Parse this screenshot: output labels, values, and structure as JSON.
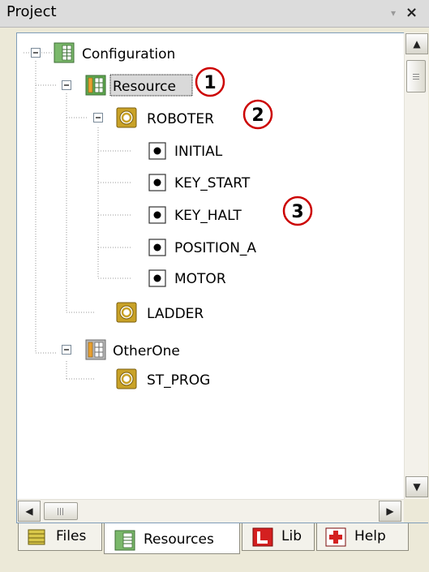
{
  "panel": {
    "title": "Project",
    "pin_glyph": "▾",
    "close_glyph": "×"
  },
  "tree": {
    "root": {
      "label": "Configuration",
      "icon": "configuration-icon"
    },
    "resource": {
      "label": "Resource",
      "icon": "resource-icon",
      "selected": true
    },
    "roboter": {
      "label": "ROBOTER",
      "icon": "program-icon"
    },
    "variables": [
      {
        "label": "INITIAL",
        "icon": "variable-icon"
      },
      {
        "label": "KEY_START",
        "icon": "variable-icon"
      },
      {
        "label": "KEY_HALT",
        "icon": "variable-icon"
      },
      {
        "label": "POSITION_A",
        "icon": "variable-icon"
      },
      {
        "label": "MOTOR",
        "icon": "variable-icon"
      }
    ],
    "ladder": {
      "label": "LADDER",
      "icon": "program-icon"
    },
    "otherone": {
      "label": "OtherOne",
      "icon": "resource-inactive-icon"
    },
    "st_prog": {
      "label": "ST_PROG",
      "icon": "program-icon"
    }
  },
  "callouts": [
    "1",
    "2",
    "3"
  ],
  "tabs": [
    {
      "label": "Files",
      "icon": "files-icon",
      "active": false
    },
    {
      "label": "Resources",
      "icon": "resources-icon",
      "active": true
    },
    {
      "label": "Lib",
      "icon": "lib-icon",
      "active": false
    },
    {
      "label": "Help",
      "icon": "help-icon",
      "active": false
    }
  ],
  "colors": {
    "selection_border": "#000000",
    "callout_border": "#cc0000",
    "program_icon": "#c9a227"
  }
}
